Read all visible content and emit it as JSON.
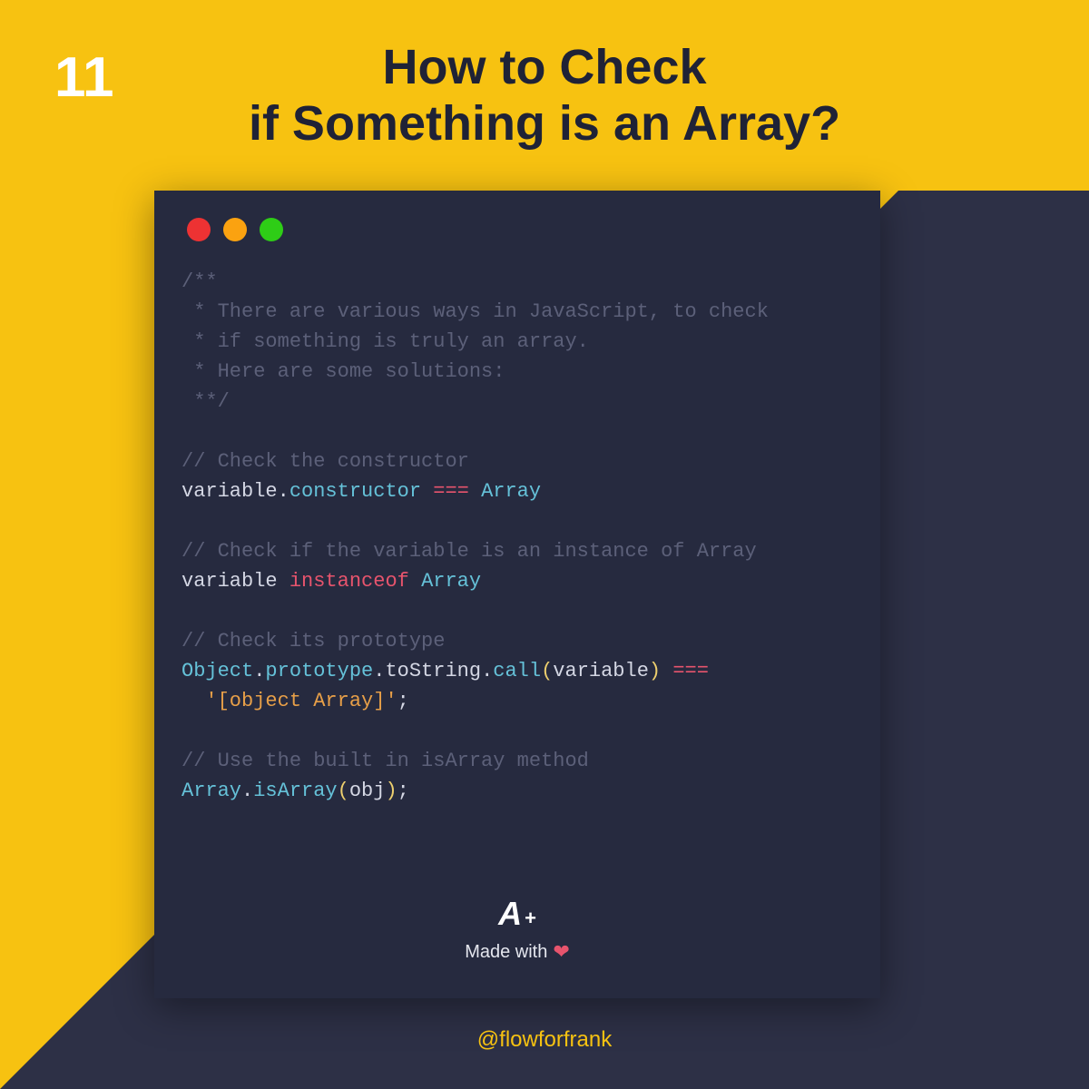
{
  "slide_number": "11",
  "title": "How to Check\nif Something is an Array?",
  "code": {
    "block_comment": "/**\n * There are various ways in JavaScript, to check\n * if something is truly an array.\n * Here are some solutions:\n **/",
    "c1_comment": "// Check the constructor",
    "c1_var": "variable",
    "c1_dot": ".",
    "c1_prop": "constructor",
    "c1_eq": " === ",
    "c1_array": "Array",
    "c2_comment": "// Check if the variable is an instance of Array",
    "c2_var": "variable",
    "c2_instanceof": " instanceof ",
    "c2_array": "Array",
    "c3_comment": "// Check its prototype",
    "c3_object": "Object",
    "c3_dot1": ".",
    "c3_prototype": "prototype",
    "c3_dot2": ".",
    "c3_tostring": "toString",
    "c3_dot3": ".",
    "c3_call": "call",
    "c3_lp": "(",
    "c3_arg": "variable",
    "c3_rp": ")",
    "c3_eq": " ===",
    "c3_str": "'[object Array]'",
    "c3_semi": ";",
    "c4_comment": "// Use the built in isArray method",
    "c4_array": "Array",
    "c4_dot": ".",
    "c4_isarray": "isArray",
    "c4_lp": "(",
    "c4_arg": "obj",
    "c4_rp": ")",
    "c4_semi": ";"
  },
  "footer": {
    "logo_a": "A",
    "logo_plus": "+",
    "made_with": "Made with"
  },
  "handle": "@flowforfrank"
}
